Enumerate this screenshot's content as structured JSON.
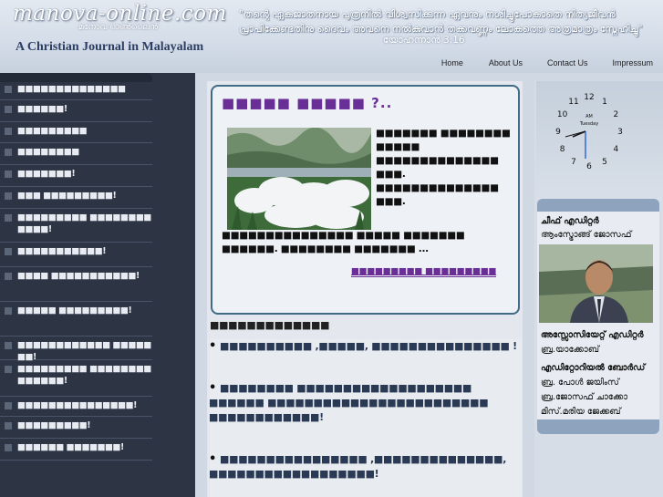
{
  "header": {
    "logo": "manova-online.com",
    "logo_sub": "മനോവ ഓൺലൈൻ",
    "tagline": "A Christian Journal in Malayalam",
    "quote_line1": "\"തന്റെ ഏകജാതനായ പുത്രനിൽ വിശ്വസിക്കുന്ന ഏവനും നശിച്ചുപോകാതെ നിത്യജീവൻ",
    "quote_line2": "പ്രാപിക്കേണ്ടതിനു ദൈവം അവനെ നൽകുവാൻ തക്കവണ്ണം ലോകത്തെ അത്രമാത്രം സ്നേഹിച്ചു\"",
    "quote_ref": "യോഹന്നാൻ 3:16"
  },
  "nav": [
    {
      "label": "Home"
    },
    {
      "label": "About Us"
    },
    {
      "label": "Contact Us"
    },
    {
      "label": "Impressum"
    }
  ],
  "sidebar": {
    "items": [
      {
        "label": "■■■■■■■■■■■■■■"
      },
      {
        "label": "■■■■■■!"
      },
      {
        "label": "■■■■■■■■■"
      },
      {
        "label": "■■■■■■■■"
      },
      {
        "label": "■■■■■■■!"
      },
      {
        "label": "■■■ ■■■■■■■■■!"
      },
      {
        "label": "■■■■■■■■■ ■■■■■■■■■■■■!"
      },
      {
        "label": "■■■■■■■■■■■!"
      },
      {
        "label": "■■■■ ■■■■■■■■■■■!"
      },
      {
        "label": "■■■■■ ■■■■■■■■■!"
      },
      {
        "label": "■■■■■■■■■■■■ ■■■■■■■!"
      },
      {
        "label": "■■■■■■■■■ ■■■■■■■■■■■■■■!"
      },
      {
        "label": "■■■■■■■■■■■■■■■!"
      },
      {
        "label": "■■■■■■■■■!"
      },
      {
        "label": "■■■■■■ ■■■■■■■!"
      }
    ]
  },
  "featured": {
    "title": "■■■■■ ■■■■■ ?..",
    "text_side": "■■■■■■■ ■■■■■■■■ ■■■■■ ■■■■■■■■■■■■■■ ■■■. ■■■■■■■■■■■■■■ ■■■.",
    "text_bottom": "■■■■■■■■■■■■■■■ ■■■■■ ■■■■■■■ ■■■■■■. ■■■■■■■■ ■■■■■■■ ...",
    "more_label": "■■■■■■■■■ ■■■■■■■■■"
  },
  "news": {
    "heading": "■■■■■■■■■■■■■",
    "items": [
      {
        "text": "■■■■■■■■■■ ,■■■■■, ■■■■■■■■■■■■■■■ !"
      },
      {
        "text": "■■■■■■■■ ■■■■■■■■■■■■■■■■■■■ ■■■■■■ ■■■■■■■■■■■■■■■■■■■■■■■■ ■■■■■■■■■■■■!"
      },
      {
        "text": "■■■■■■■■■■■■■■■■ ,■■■■■■■■■■■■■■, ■■■■■■■■■■■■■■■■■■!"
      }
    ]
  },
  "clock": {
    "numbers": [
      "12",
      "1",
      "2",
      "3",
      "4",
      "5",
      "6",
      "7",
      "8",
      "9",
      "10",
      "11"
    ],
    "ampm": "AM",
    "day": "Tuesday"
  },
  "staff": {
    "chief_title": "ചീഫ് എഡിറ്റർ",
    "chief_name": "ആംസ്ട്രോങ്ങ് ജോസഫ്",
    "assoc_title": "അസ്സോസിയേറ്റ് എഡിറ്റർ",
    "assoc_name": "ബ്ര.യാക്കോബ്",
    "board_title": "എഡിറ്റോറിയൽ ബോർഡ്",
    "board_members": [
      "ബ്ര. പോൾ ജയിംസ്",
      "ബ്ര.ജോസഫ് ചാക്കോ",
      "മിസ്.മരിയ ജേക്കബ്"
    ]
  },
  "colors": {
    "sidebar_bg": "#2d3545",
    "accent_purple": "#6a2f97",
    "featured_border": "#3f6b85"
  }
}
